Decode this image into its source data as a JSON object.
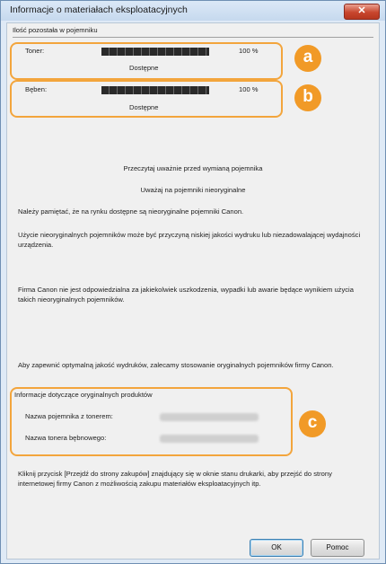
{
  "window": {
    "title": "Informacje o materiałach eksploatacyjnych",
    "close_label": "✕"
  },
  "remaining_section": {
    "header": "Ilość pozostała w pojemniku"
  },
  "toner": {
    "label": "Toner:",
    "percent": "100 %",
    "status": "Dostępne",
    "level": 1.0
  },
  "drum": {
    "label": "Bęben:",
    "percent": "100 %",
    "status": "Dostępne",
    "level": 1.0
  },
  "notice": {
    "line1": "Przeczytaj uważnie przed wymianą pojemnika",
    "line2": "Uważaj na pojemniki nieoryginalne",
    "para1": "Należy pamiętać, że na rynku dostępne są nieoryginalne pojemniki Canon.",
    "para2": "Użycie nieoryginalnych pojemników może być przyczyną niskiej jakości wydruku lub niezadowalającej wydajności urządzenia.",
    "para3": "Firma Canon nie jest odpowiedzialna za jakiekolwiek uszkodzenia, wypadki lub awarie będące wynikiem użycia takich nieoryginalnych pojemników.",
    "para4": "Aby zapewnić optymalną jakość wydruków, zalecamy stosowanie oryginalnych pojemników firmy Canon."
  },
  "product_info": {
    "header": "Informacje dotyczące oryginalnych produktów",
    "toner_name_label": "Nazwa pojemnika z tonerem:",
    "drum_name_label": "Nazwa tonera bębnowego:"
  },
  "footer_text": "Kliknij przycisk [Przejdź do strony zakupów] znajdujący się w oknie stanu drukarki, aby przejść do strony internetowej firmy Canon z możliwością zakupu materiałów eksploatacyjnych itp.",
  "buttons": {
    "ok": "OK",
    "help": "Pomoc"
  },
  "callouts": {
    "a": "a",
    "b": "b",
    "c": "c"
  },
  "colors": {
    "callout": "#f19a27",
    "title_bar": "#c6d9ee"
  }
}
